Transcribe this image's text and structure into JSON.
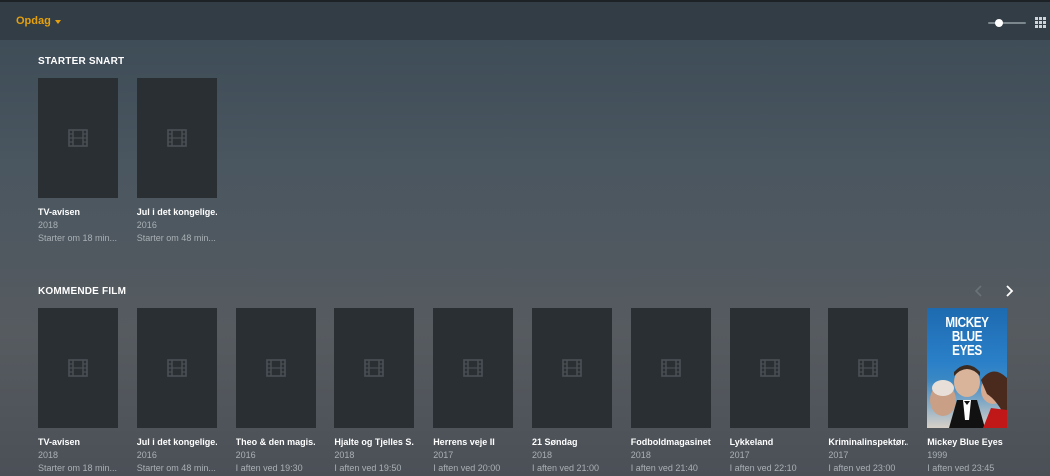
{
  "topbar": {
    "menu_label": "Opdag",
    "size_slider_level": 0.3,
    "accent": "#e5a00d"
  },
  "sections": {
    "starting_soon": {
      "title": "STARTER SNART",
      "items": [
        {
          "title": "TV-avisen",
          "year": "2018",
          "time": "Starter om 18 min..."
        },
        {
          "title": "Jul i det kongelige...",
          "year": "2016",
          "time": "Starter om 48 min..."
        }
      ]
    },
    "upcoming": {
      "title": "KOMMENDE FILM",
      "items": [
        {
          "title": "TV-avisen",
          "year": "2018",
          "time": "Starter om 18 min..."
        },
        {
          "title": "Jul i det kongelige...",
          "year": "2016",
          "time": "Starter om 48 min..."
        },
        {
          "title": "Theo & den magis...",
          "year": "2016",
          "time": "I aften ved 19:30"
        },
        {
          "title": "Hjalte og Tjelles S...",
          "year": "2018",
          "time": "I aften ved 19:50"
        },
        {
          "title": "Herrens veje II",
          "year": "2017",
          "time": "I aften ved 20:00"
        },
        {
          "title": "21 Søndag",
          "year": "2018",
          "time": "I aften ved 21:00"
        },
        {
          "title": "Fodboldmagasinet",
          "year": "2018",
          "time": "I aften ved 21:40"
        },
        {
          "title": "Lykkeland",
          "year": "2017",
          "time": "I aften ved 22:10"
        },
        {
          "title": "Kriminalinspektør...",
          "year": "2017",
          "time": "I aften ved 23:00"
        },
        {
          "title": "Mickey Blue Eyes",
          "year": "1999",
          "time": "I aften ved 23:45",
          "poster_text": "MICKEY BLUE EYES"
        }
      ]
    }
  },
  "icons": {
    "placeholder": "film-strip-icon",
    "prev": "chevron-left-icon",
    "next": "chevron-right-icon",
    "view": "grid-view-icon"
  }
}
